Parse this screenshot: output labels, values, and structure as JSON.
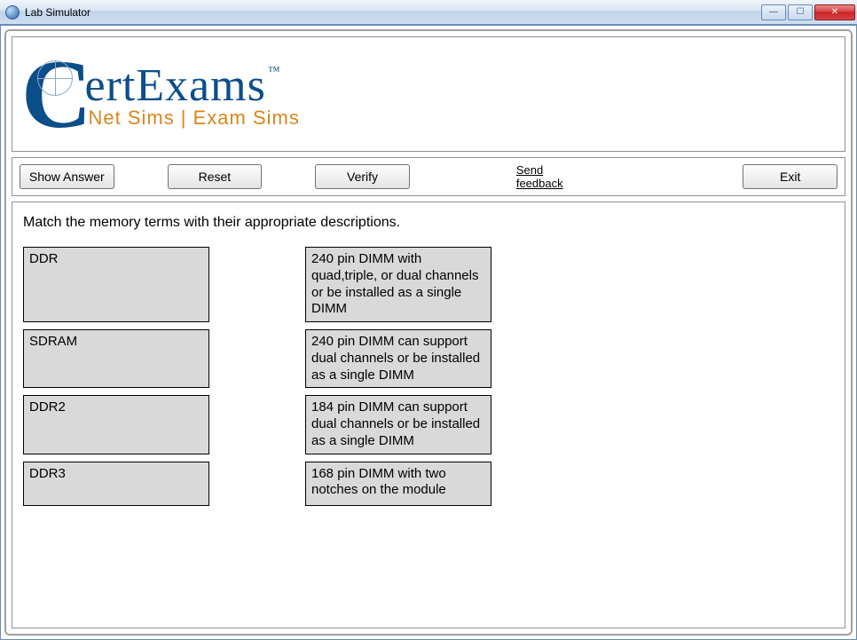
{
  "window": {
    "title": "Lab Simulator"
  },
  "logo": {
    "main": "ertExams",
    "tm": "™",
    "sub": "Net Sims | Exam Sims"
  },
  "toolbar": {
    "show_answer": "Show Answer",
    "reset": "Reset",
    "verify": "Verify",
    "feedback": "Send feedback",
    "exit": "Exit"
  },
  "question": {
    "prompt": "Match the memory terms with their appropriate descriptions.",
    "left": [
      "DDR",
      "SDRAM",
      "DDR2",
      "DDR3"
    ],
    "right": [
      "240 pin DIMM with quad,triple, or dual channels or be installed as a single DIMM",
      "240 pin DIMM can support dual channels or be installed as a single DIMM",
      "184 pin DIMM can support dual channels or be installed as a single DIMM",
      "168 pin DIMM with two notches on the module"
    ]
  }
}
